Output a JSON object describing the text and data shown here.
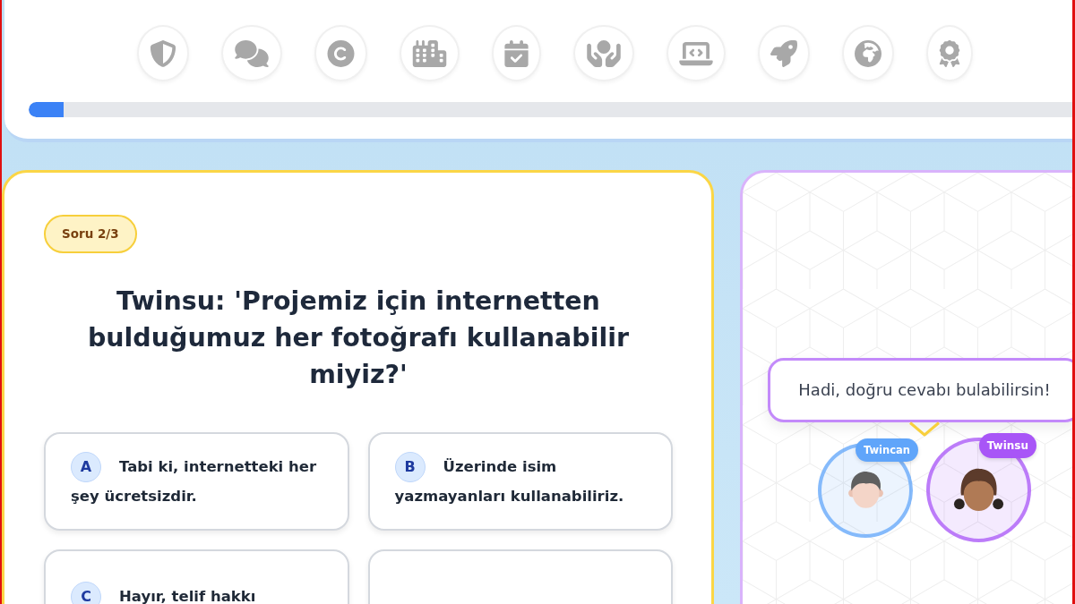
{
  "progress": {
    "level": 0.033
  },
  "question": {
    "badge": "Soru 2/3",
    "text": "Twinsu: 'Projemiz için internetten bulduğumuz her fotoğrafı kullanabilir miyiz?'"
  },
  "options": [
    {
      "letter": "A",
      "text": "Tabi ki, internetteki her şey ücretsizdir.",
      "selected": false
    },
    {
      "letter": "B",
      "text": "Üzerinde isim yazmayanları kullanabiliriz.",
      "selected": false
    },
    {
      "letter": "C",
      "text": "Hayır, telif hakkı",
      "selected": false
    },
    {
      "selected": false
    }
  ],
  "speech_bubble": {
    "text": "Hadi, doğru cevabı bulabilirsin!"
  },
  "characters": [
    {
      "name": "Twincan",
      "kind": "boy",
      "color": "#60a5fa",
      "active": false
    },
    {
      "name": "Twinsu",
      "kind": "girl",
      "color": "#a855f7",
      "active": true
    }
  ]
}
